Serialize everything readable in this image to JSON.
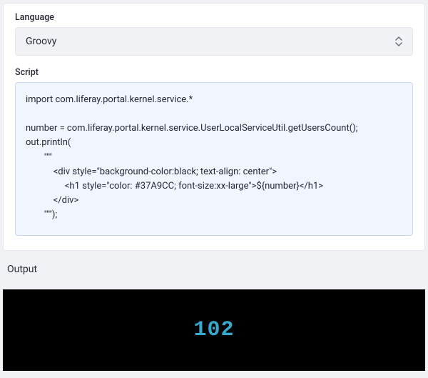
{
  "language": {
    "label": "Language",
    "value": "Groovy"
  },
  "script": {
    "label": "Script",
    "code": "import com.liferay.portal.kernel.service.*\n\nnumber = com.liferay.portal.kernel.service.UserLocalServiceUtil.getUsersCount();\nout.println(\n        \"\"\"\n            <div style=\"background-color:black; text-align: center\">\n                 <h1 style=\"color: #37A9CC; font-size:xx-large\">${number}</h1>\n            </div>\n        \"\"\");"
  },
  "output": {
    "label": "Output",
    "value": "102",
    "color": "#37A9CC"
  }
}
